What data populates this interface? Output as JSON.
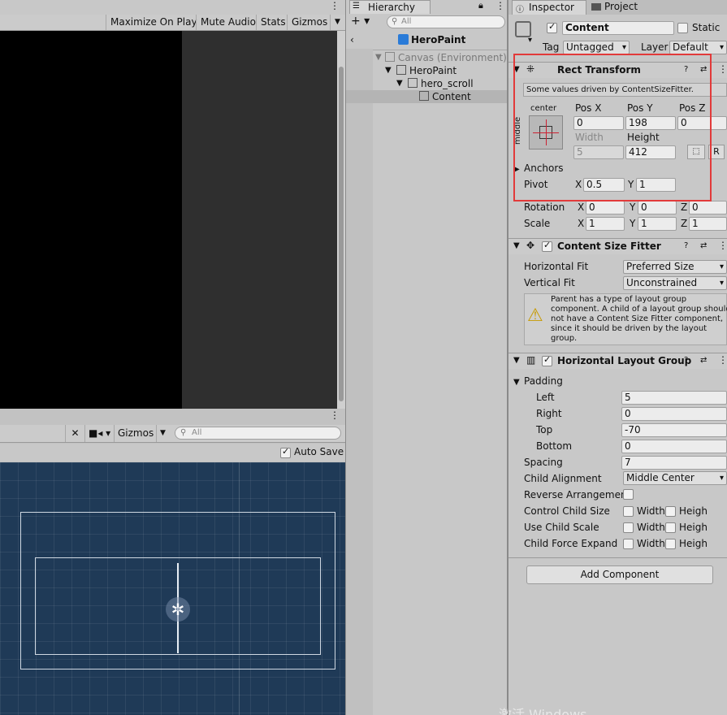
{
  "game": {
    "toolbar": [
      "Maximize On Play",
      "Mute Audio",
      "Stats",
      "Gizmos"
    ],
    "dots": "⋮"
  },
  "scene": {
    "gizmos": "Gizmos",
    "search_placeholder": "All",
    "auto_save": "Auto Save",
    "dots": "⋮"
  },
  "hierarchy": {
    "tab": "Hierarchy",
    "search_placeholder": "All",
    "title": "HeroPaint",
    "rows": [
      {
        "label": "Canvas (Environment)",
        "indent": 1
      },
      {
        "label": "HeroPaint",
        "indent": 2
      },
      {
        "label": "hero_scroll",
        "indent": 3
      },
      {
        "label": "Content",
        "indent": 4
      }
    ]
  },
  "inspector": {
    "tabs": [
      "Inspector",
      "Project"
    ],
    "object_name": "Content",
    "static_label": "Static",
    "tag_label": "Tag",
    "tag_value": "Untagged",
    "layer_label": "Layer",
    "layer_value": "Default",
    "rect_transform": {
      "title": "Rect Transform",
      "info": "Some values driven by ContentSizeFitter.",
      "anchor_h": "center",
      "anchor_v": "middle",
      "headers": [
        "Pos X",
        "Pos Y",
        "Pos Z"
      ],
      "pos": [
        "0",
        "198",
        "0"
      ],
      "size_headers": [
        "Width",
        "Height"
      ],
      "size": [
        "5",
        "412"
      ],
      "r_label": "R",
      "anchors_label": "Anchors",
      "pivot_label": "Pivot",
      "pivot_x_label": "X",
      "pivot_x": "0.5",
      "pivot_y_label": "Y",
      "pivot_y": "1",
      "rotation_label": "Rotation",
      "rotation": [
        "0",
        "0",
        "0"
      ],
      "scale_label": "Scale",
      "scale": [
        "1",
        "1",
        "1"
      ],
      "axis": [
        "X",
        "Y",
        "Z"
      ]
    },
    "content_size_fitter": {
      "title": "Content Size Fitter",
      "horizontal_label": "Horizontal Fit",
      "horizontal_value": "Preferred Size",
      "vertical_label": "Vertical Fit",
      "vertical_value": "Unconstrained",
      "warning_lines": [
        "Parent has a type of layout group",
        "component. A child of a layout group should",
        "not have a Content Size Fitter component,",
        "since it should be driven by the layout",
        "group."
      ]
    },
    "horizontal_layout_group": {
      "title": "Horizontal Layout Group",
      "padding_label": "Padding",
      "left_label": "Left",
      "left": "5",
      "right_label": "Right",
      "right": "0",
      "top_label": "Top",
      "top": "-70",
      "bottom_label": "Bottom",
      "bottom": "0",
      "spacing_label": "Spacing",
      "spacing": "7",
      "child_alignment_label": "Child Alignment",
      "child_alignment": "Middle Center",
      "reverse_label": "Reverse Arrangement",
      "control_label": "Control Child Size",
      "scale_label": "Use Child Scale",
      "expand_label": "Child Force Expand",
      "width": "Width",
      "height": "Heigh"
    },
    "add_component": "Add Component",
    "watermark": "激活 Windows"
  }
}
